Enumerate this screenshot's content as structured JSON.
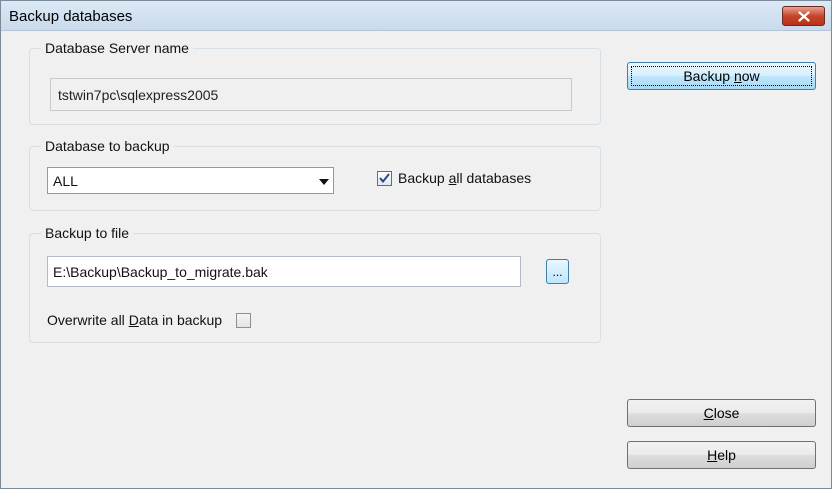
{
  "window": {
    "title": "Backup databases",
    "close_icon": "close-x-icon",
    "accent_close": "#c7452c"
  },
  "server_group": {
    "legend": "Database Server name",
    "value": "tstwin7pc\\sqlexpress2005"
  },
  "database_group": {
    "legend": "Database to backup",
    "selected": "ALL",
    "backup_all": {
      "label_pre": "Backup ",
      "label_hot": "a",
      "label_post": "ll databases",
      "checked": true
    }
  },
  "file_group": {
    "legend": "Backup to file",
    "path": "E:\\Backup\\Backup_to_migrate.bak",
    "browse_label": "...",
    "overwrite": {
      "label_pre": "Overwrite all ",
      "label_hot": "D",
      "label_post": "ata in backup",
      "checked": false
    }
  },
  "buttons": {
    "backup_pre": "Backup ",
    "backup_hot": "n",
    "backup_post": "ow",
    "close_hot": "C",
    "close_post": "lose",
    "help_hot": "H",
    "help_post": "elp"
  }
}
